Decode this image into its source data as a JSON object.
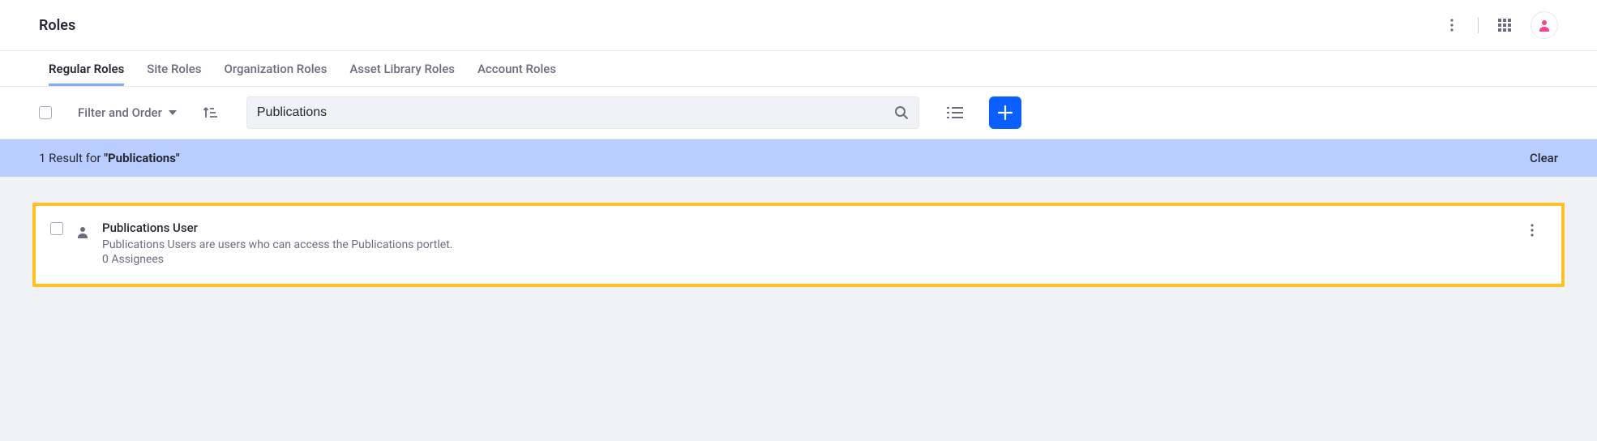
{
  "header": {
    "title": "Roles"
  },
  "tabs": [
    {
      "label": "Regular Roles",
      "active": true
    },
    {
      "label": "Site Roles",
      "active": false
    },
    {
      "label": "Organization Roles",
      "active": false
    },
    {
      "label": "Asset Library Roles",
      "active": false
    },
    {
      "label": "Account Roles",
      "active": false
    }
  ],
  "toolbar": {
    "filter_label": "Filter and Order",
    "search_value": "Publications"
  },
  "result_bar": {
    "count_text": "1 Result for ",
    "query": "\"Publications\"",
    "clear_label": "Clear"
  },
  "results": [
    {
      "title": "Publications User",
      "description": "Publications Users are users who can access the Publications portlet.",
      "assignees": "0 Assignees"
    }
  ]
}
